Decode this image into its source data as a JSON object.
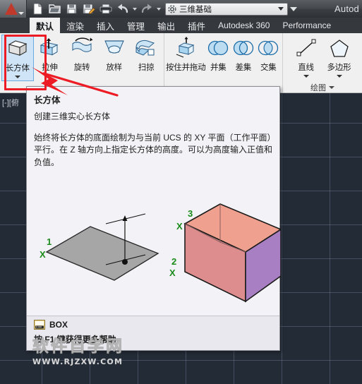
{
  "titlebar": {
    "app_menu": "A",
    "window_title": "Autod",
    "quick_access": [
      {
        "name": "new-file",
        "label": "新建"
      },
      {
        "name": "open-file",
        "label": "打开"
      },
      {
        "name": "save-file",
        "label": "保存"
      },
      {
        "name": "save-as-file",
        "label": "另存为"
      },
      {
        "name": "print",
        "label": "打印"
      },
      {
        "name": "undo",
        "label": "放弃"
      },
      {
        "name": "redo",
        "label": "重做"
      }
    ],
    "workspace": {
      "value": "三维基础",
      "icon": "gear-icon"
    }
  },
  "ribbon": {
    "tabs": [
      {
        "label": "默认",
        "active": true,
        "latin": false
      },
      {
        "label": "渲染",
        "active": false,
        "latin": false
      },
      {
        "label": "插入",
        "active": false,
        "latin": false
      },
      {
        "label": "管理",
        "active": false,
        "latin": false
      },
      {
        "label": "输出",
        "active": false,
        "latin": false
      },
      {
        "label": "插件",
        "active": false,
        "latin": false
      },
      {
        "label": "Autodesk 360",
        "active": false,
        "latin": true
      },
      {
        "label": "Performance",
        "active": false,
        "latin": true
      }
    ],
    "panels": [
      {
        "title": "",
        "tools": [
          {
            "label": "长方体",
            "icon": "box-icon",
            "dropdown": true,
            "selected": true
          },
          {
            "label": "拉伸",
            "icon": "extrude-icon",
            "dropdown": false,
            "selected": false
          },
          {
            "label": "旋转",
            "icon": "revolve-icon",
            "dropdown": false,
            "selected": false
          },
          {
            "label": "放样",
            "icon": "loft-icon",
            "dropdown": false,
            "selected": false
          },
          {
            "label": "扫掠",
            "icon": "sweep-icon",
            "dropdown": false,
            "selected": false
          }
        ]
      },
      {
        "title": "",
        "tools": [
          {
            "label": "按住并拖动",
            "icon": "presspull-icon",
            "dropdown": false,
            "selected": false
          },
          {
            "label": "并集",
            "icon": "union-icon",
            "dropdown": false,
            "selected": false
          },
          {
            "label": "差集",
            "icon": "subtract-icon",
            "dropdown": false,
            "selected": false
          },
          {
            "label": "交集",
            "icon": "intersect-icon",
            "dropdown": false,
            "selected": false
          }
        ]
      },
      {
        "title": "绘图",
        "tools": [
          {
            "label": "直线",
            "icon": "line-icon",
            "dropdown": true,
            "selected": false
          },
          {
            "label": "多边形",
            "icon": "polygon-icon",
            "dropdown": true,
            "selected": false
          }
        ]
      }
    ]
  },
  "tooltip": {
    "title": "长方体",
    "subtitle": "创建三维实心长方体",
    "body_line1": "始终将长方体的底面绘制为与当前 UCS 的 XY 平面（工作平面）",
    "body_line2": "平行。在 Z 轴方向上指定长方体的高度。可以为高度输入正值和",
    "body_line3": "负值。",
    "command_name": "BOX",
    "command_icon": "command-line-icon",
    "help_hint": "按 F1 键获得更多帮助",
    "illustration": {
      "labels": [
        {
          "number": "1",
          "marker": "X"
        },
        {
          "number": "2",
          "marker": "X"
        },
        {
          "number": "3",
          "marker": "X"
        }
      ],
      "colors": {
        "top_face": "#f0a08e",
        "front_face": "#dd8d8d",
        "side_face": "#a97fc4",
        "base_face": "#a6a6a6",
        "marker": "#1a8a1a"
      }
    }
  },
  "canvas": {
    "viewport_label": "[-][俯",
    "background": "#232b36",
    "grid_color": "#94a0bc"
  },
  "annotation": {
    "highlight_color": "#ed1c24",
    "highlight_target": "长方体"
  },
  "watermark": {
    "main": "软件自学网",
    "sub": "WWW.RJZXW.COM"
  }
}
